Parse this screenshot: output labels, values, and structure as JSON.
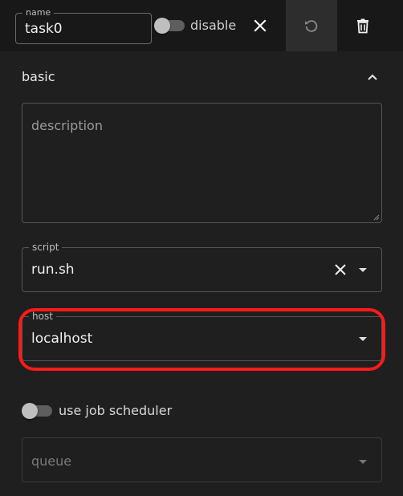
{
  "header": {
    "name_legend": "name",
    "name_value": "task0",
    "disable_label": "disable",
    "disable_on": false,
    "icons": {
      "close": "close-icon",
      "refresh": "refresh-icon",
      "delete": "trash-icon"
    }
  },
  "section": {
    "title": "basic",
    "expanded": true
  },
  "description": {
    "placeholder": "description",
    "value": ""
  },
  "script": {
    "legend": "script",
    "value": "run.sh"
  },
  "host": {
    "legend": "host",
    "value": "localhost",
    "highlight_color": "#ff1a1a"
  },
  "scheduler": {
    "label": "use job scheduler",
    "on": false
  },
  "queue": {
    "placeholder": "queue",
    "disabled": true
  }
}
